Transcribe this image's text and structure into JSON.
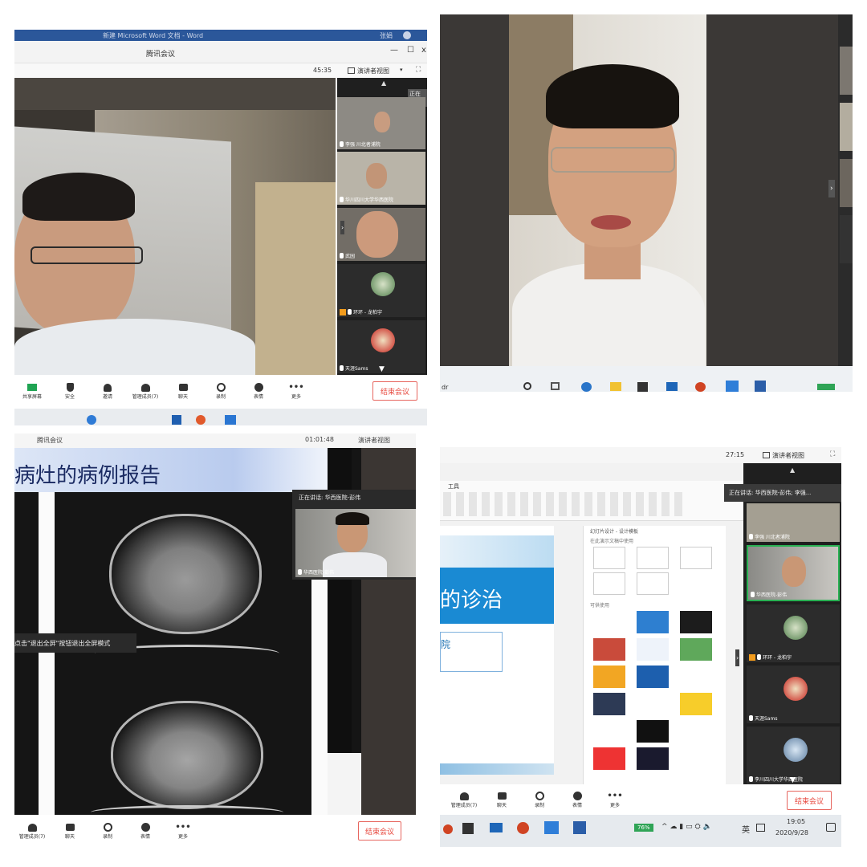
{
  "q1": {
    "os_title": "新建 Microsoft Word 文档 - Word",
    "os_user": "张娟",
    "app_title": "腾讯会议",
    "timer": "45:35",
    "view_mode": "演讲者视图",
    "speaking_tag": "正在讲",
    "participants": [
      {
        "name": "李强 川北者浦院"
      },
      {
        "name": "华川四川大学华西医院"
      },
      {
        "name": "武园"
      },
      {
        "name": "环环 - 龙柏宇"
      },
      {
        "name": "天涯Sams"
      }
    ],
    "toolbar": [
      "共享屏幕",
      "安全",
      "邀请",
      "管理成员(7)",
      "聊天",
      "录制",
      "表情",
      "更多"
    ],
    "end_label": "结束会议"
  },
  "q2": {
    "taskbar_left": "dr"
  },
  "q3": {
    "app_title": "腾讯会议",
    "timer": "01:01:48",
    "view_mode": "演讲者视图",
    "slide_title": "病灶的病例报告",
    "speaking": "正在讲话: 华西医院-彭伟",
    "video_name": "华西医院-彭伟",
    "hint": "点击\"退出全屏\"按钮退出全屏模式",
    "toolbar": [
      "管理成员(7)",
      "聊天",
      "录制",
      "表情",
      "更多"
    ],
    "end_label": "结束会议"
  },
  "q4": {
    "timer": "27:15",
    "view_mode": "演讲者视图",
    "speaking": "正在讲话: 华西医院-彭伟; 李强...",
    "ribbon_tab": "工具",
    "design_title": "幻灯片设计 - 设计模板",
    "design_section1": "在此演示文稿中使用",
    "design_section2": "可供使用",
    "slide_title": "的诊治",
    "slide_sub": "院",
    "participants": [
      {
        "name": "李强 川北者浦院"
      },
      {
        "name": "华西医院-彭伟"
      },
      {
        "name": "环环 - 龙柏宇"
      },
      {
        "name": "天涯Sams"
      },
      {
        "name": "李川四川大学华西医院"
      }
    ],
    "toolbar": [
      "管理成员(7)",
      "聊天",
      "录制",
      "表情",
      "更多"
    ],
    "end_label": "结束会议",
    "battery": "76%",
    "ime": "英",
    "time": "19:05",
    "date": "2020/9/28"
  }
}
